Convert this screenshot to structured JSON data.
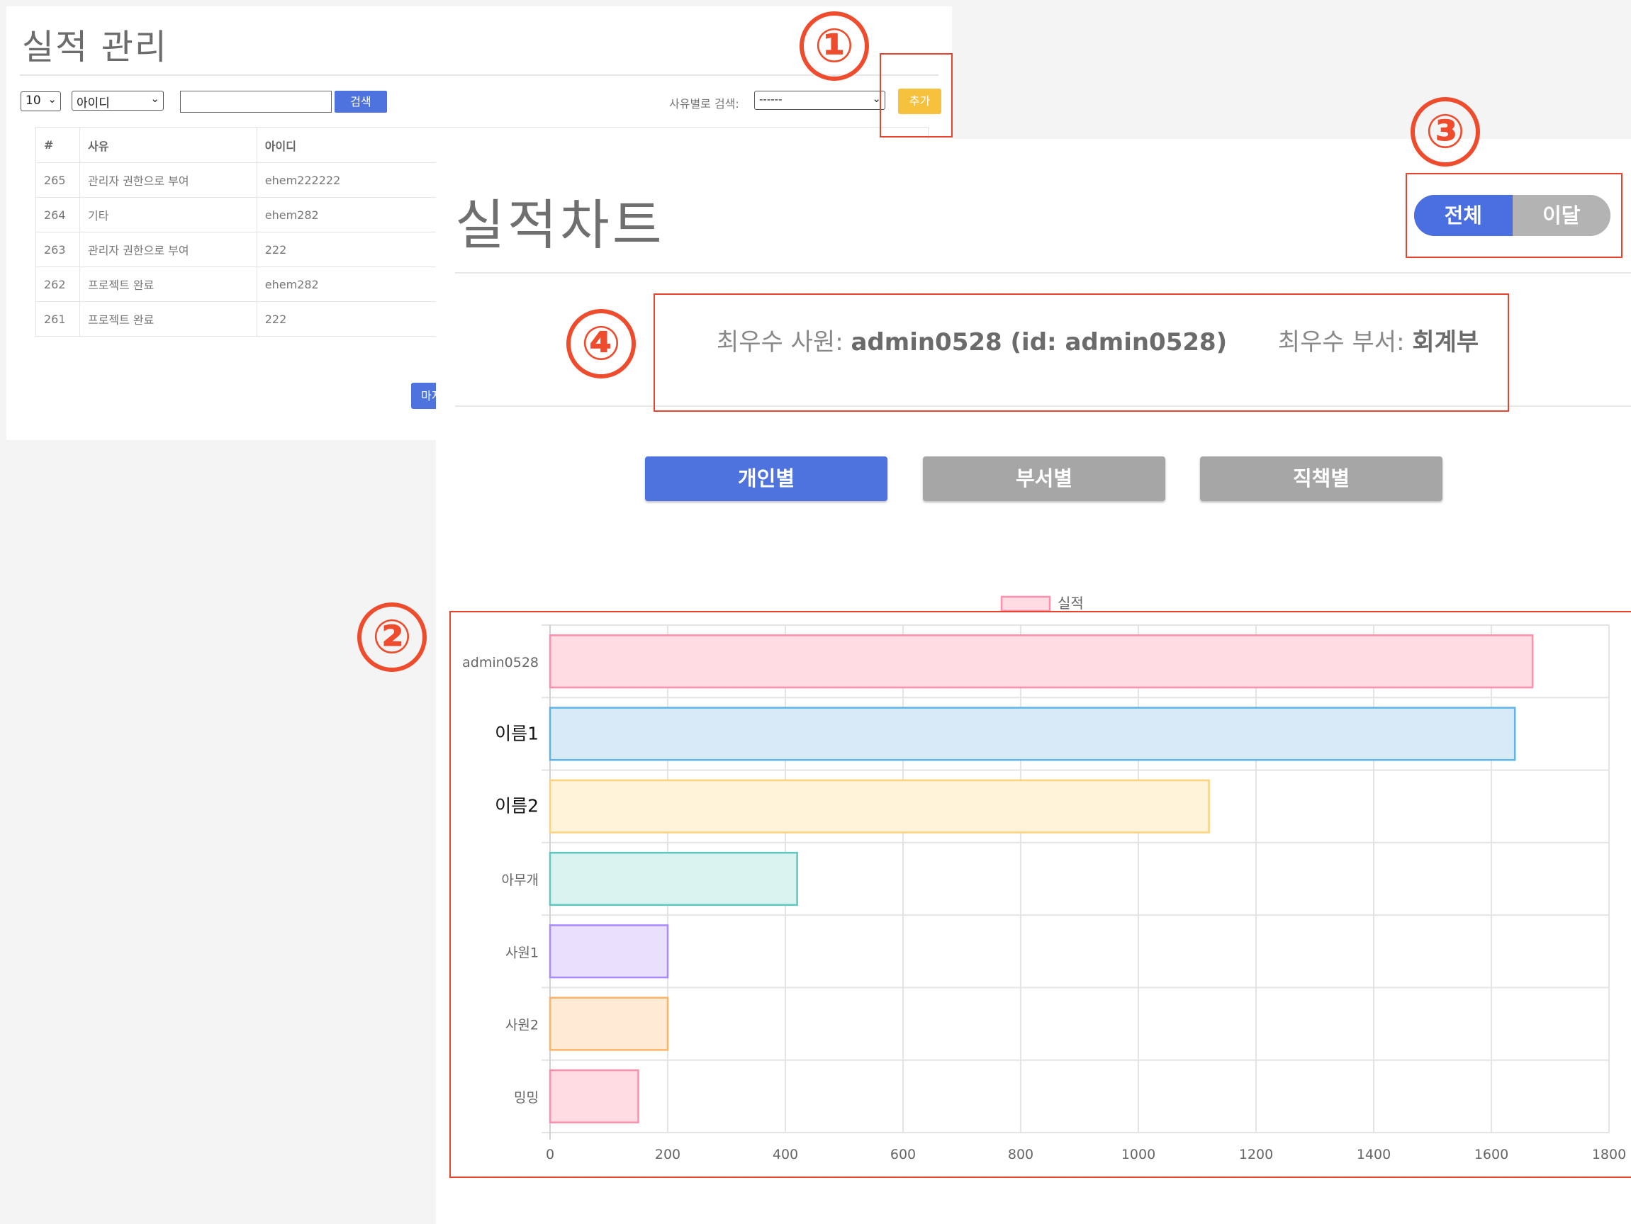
{
  "management": {
    "title": "실적 관리",
    "page_size": "10",
    "search_field": "아이디",
    "search_value": "",
    "search_button": "검색",
    "reason_filter_label": "사유별로 검색:",
    "reason_filter_value": "------",
    "add_button": "추가",
    "last_button": "마지",
    "columns": [
      "#",
      "사유",
      "아이디"
    ],
    "rows": [
      {
        "no": "265",
        "reason": "관리자 권한으로 부여",
        "id": "ehem222222"
      },
      {
        "no": "264",
        "reason": "기타",
        "id": "ehem282"
      },
      {
        "no": "263",
        "reason": "관리자 권한으로 부여",
        "id": "222"
      },
      {
        "no": "262",
        "reason": "프로젝트 완료",
        "id": "ehem282"
      },
      {
        "no": "261",
        "reason": "프로젝트 완료",
        "id": "222"
      }
    ]
  },
  "chart_page": {
    "title": "실적차트",
    "period_toggle": {
      "all": "전체",
      "this_month": "이달",
      "selected": "전체"
    },
    "best_employee_label": "최우수 사원:",
    "best_employee_value": "admin0528 (id: admin0528)",
    "best_department_label": "최우수 부서:",
    "best_department_value": "회계부",
    "tabs": [
      {
        "label": "개인별",
        "active": true
      },
      {
        "label": "부서별",
        "active": false
      },
      {
        "label": "직책별",
        "active": false
      }
    ]
  },
  "chart_data": {
    "type": "bar",
    "orientation": "horizontal",
    "categories": [
      "admin0528",
      "이름1",
      "이름2",
      "아무개",
      "사원1",
      "사원2",
      "밍밍"
    ],
    "series": [
      {
        "name": "실적",
        "values": [
          1670,
          1640,
          1120,
          420,
          200,
          200,
          150
        ]
      }
    ],
    "bar_fill_colors": [
      "#ffdbe4",
      "#d8eaf8",
      "#fff3da",
      "#d9f3f1",
      "#e9e0fd",
      "#ffead6",
      "#ffdbe4"
    ],
    "bar_border_colors": [
      "#ff8fab",
      "#5eb4e8",
      "#ffd17a",
      "#5ec7c0",
      "#a98aff",
      "#ffb369",
      "#ff8fab"
    ],
    "xlim": [
      0,
      1800
    ],
    "xticks": [
      0,
      200,
      400,
      600,
      800,
      1000,
      1200,
      1400,
      1600,
      1800
    ],
    "grid": true,
    "legend_position": "top"
  },
  "annotations": [
    "①",
    "②",
    "③",
    "④"
  ],
  "colors": {
    "accent": "#4e73df",
    "warning": "#f6c23e",
    "annotation": "#ee4c2c",
    "inactive": "#a6a6a6"
  }
}
